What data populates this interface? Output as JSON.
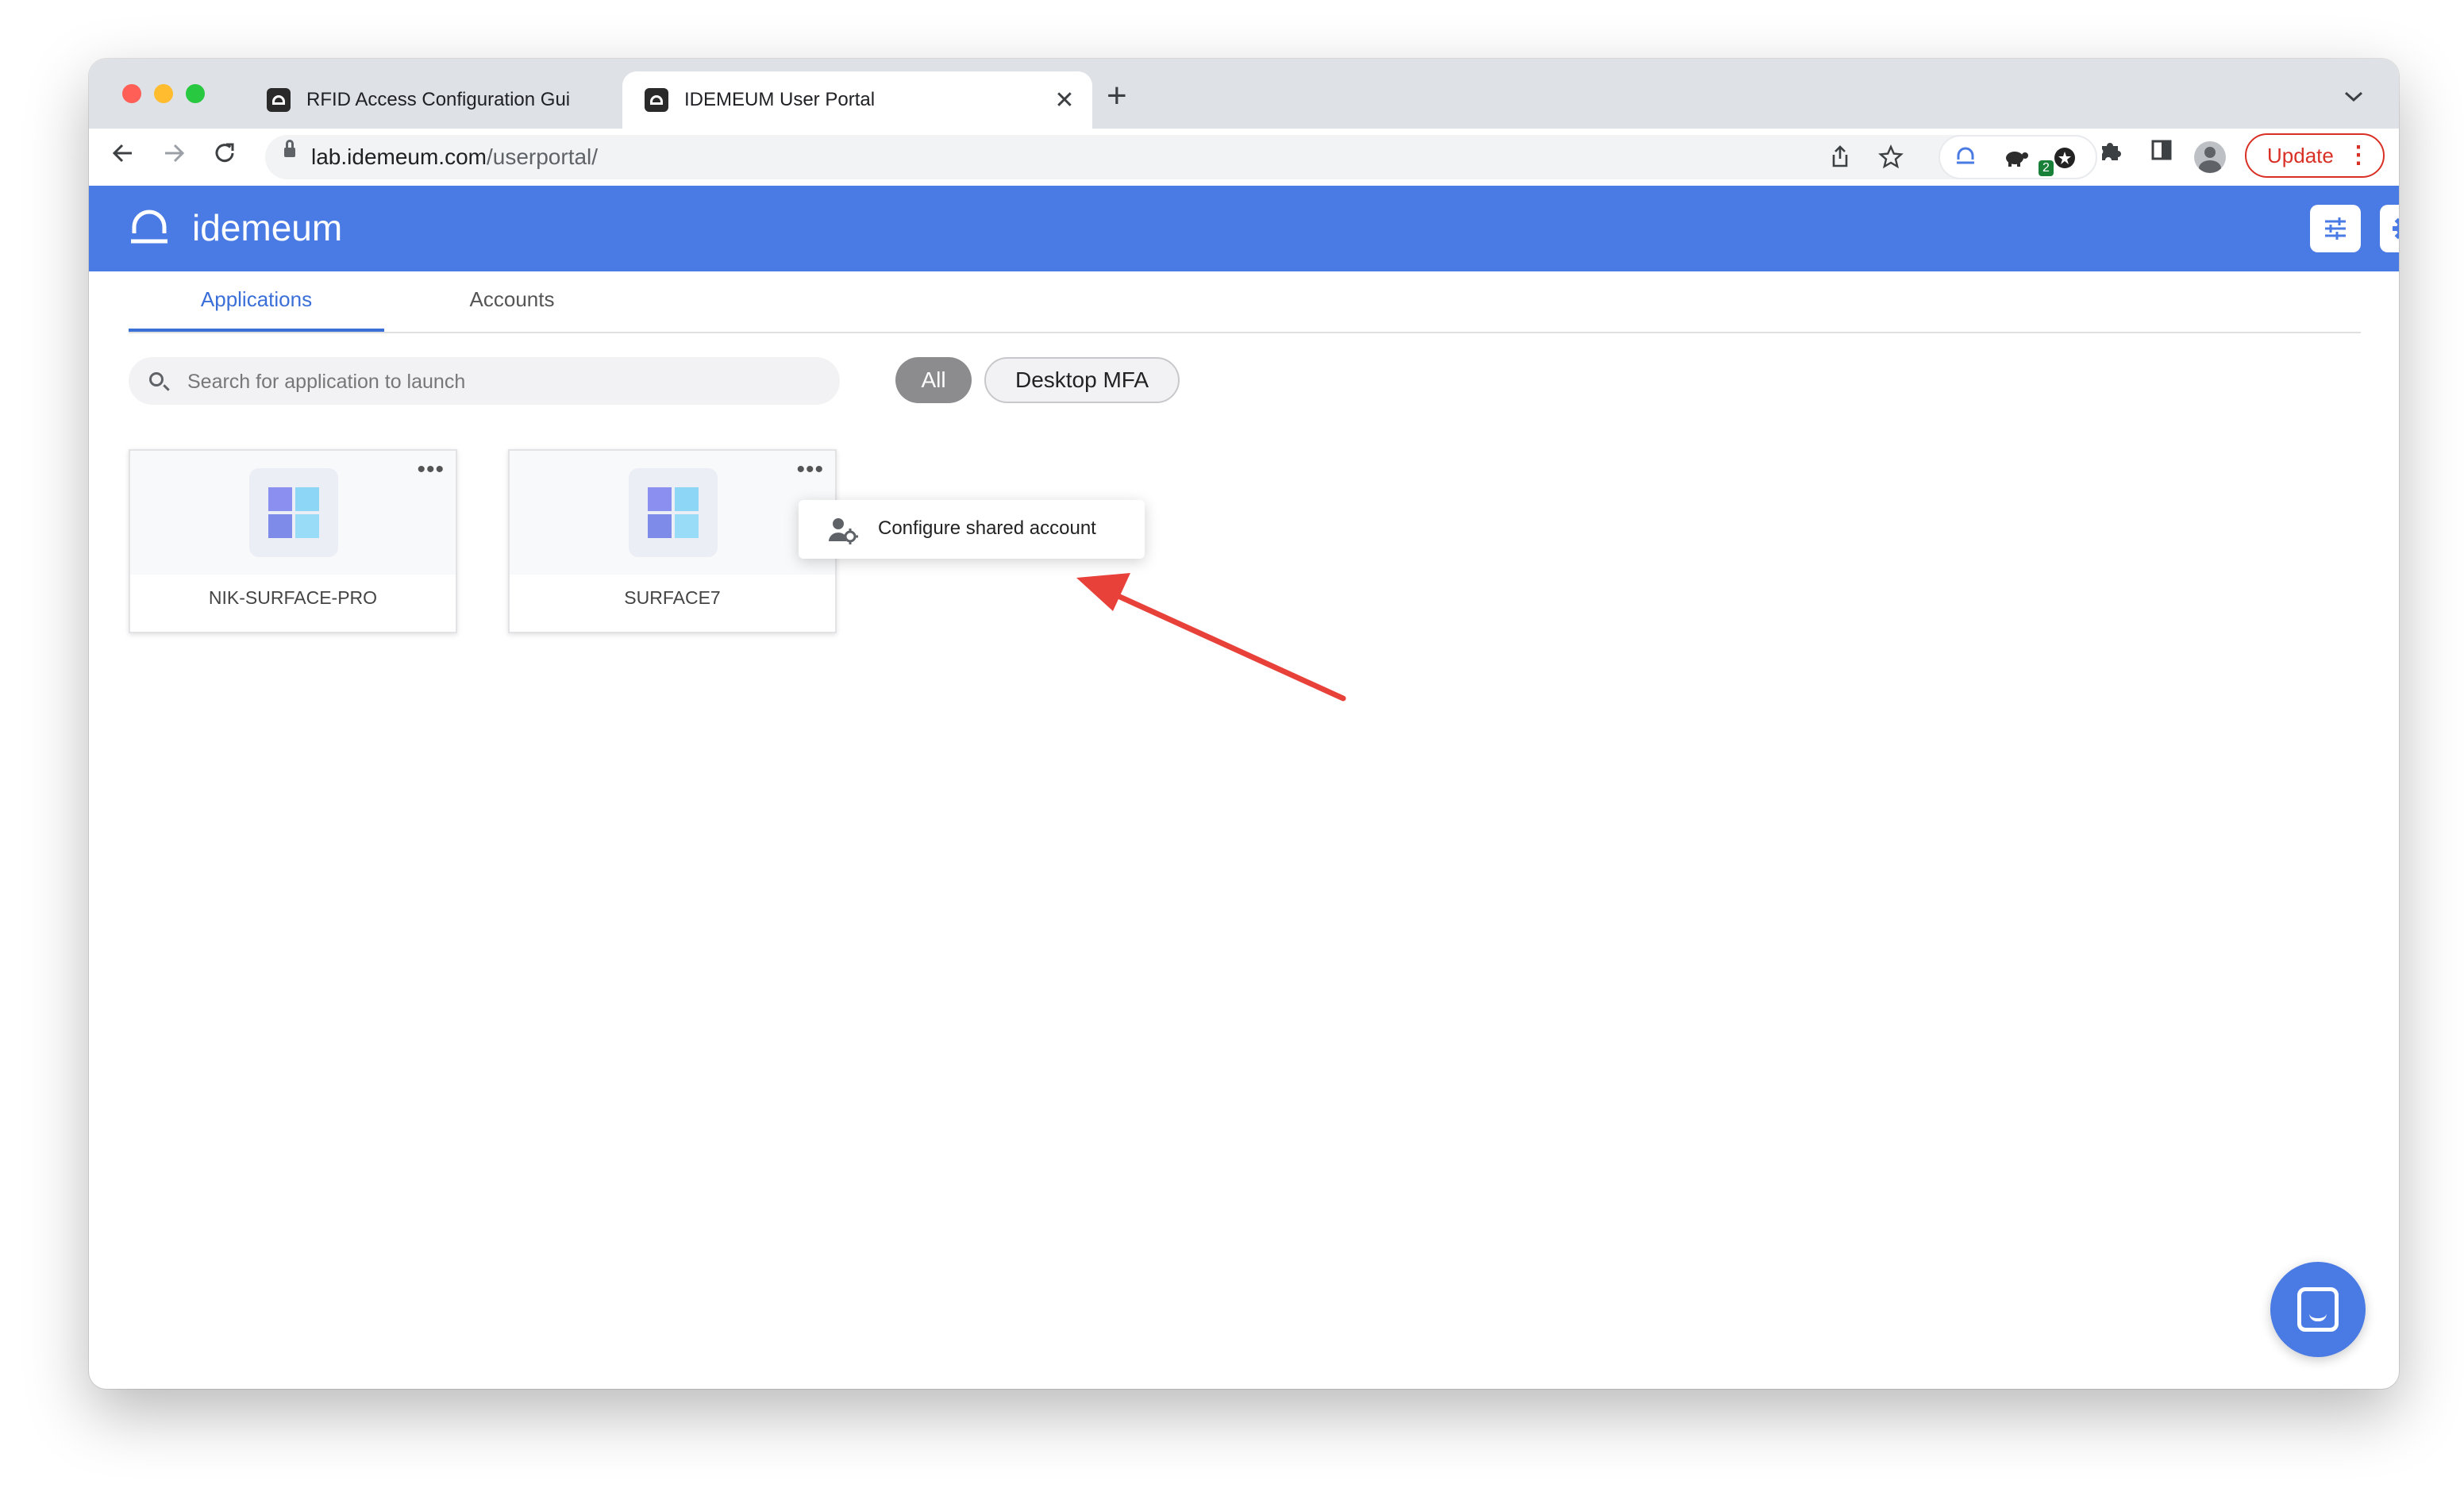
{
  "browser": {
    "tabs": [
      {
        "title": "RFID Access Configuration Gui",
        "active": false
      },
      {
        "title": "IDEMEUM User Portal",
        "active": true
      }
    ],
    "new_tab_symbol": "+",
    "close_symbol": "✕",
    "tab_menu_symbol": "⌄",
    "url_host": "lab.idemeum.com",
    "url_path": "/userportal/",
    "update_label": "Update",
    "extension_badge": "2",
    "icons": [
      "back-icon",
      "forward-icon",
      "reload-icon",
      "lock-icon",
      "share-icon",
      "bookmark-star-icon",
      "idemeum-extension-icon",
      "turtle-extension-icon",
      "badge-extension-icon",
      "puzzle-extensions-icon",
      "side-panel-icon",
      "profile-avatar-icon",
      "more-vert-icon"
    ]
  },
  "app": {
    "brand": "idemeum",
    "brand_color": "#4a7be4",
    "header_icons": [
      "tune-icon",
      "settings-gear-icon"
    ],
    "tabs": [
      {
        "label": "Applications",
        "active": true
      },
      {
        "label": "Accounts",
        "active": false
      }
    ],
    "search": {
      "placeholder": "Search for application to launch",
      "value": ""
    },
    "filters": [
      {
        "label": "All",
        "selected": true
      },
      {
        "label": "Desktop MFA",
        "selected": false
      }
    ],
    "cards": [
      {
        "name": "NIK-SURFACE-PRO",
        "icon": "windows-logo-icon"
      },
      {
        "name": "SURFACE7",
        "icon": "windows-logo-icon"
      }
    ],
    "context_menu": {
      "items": [
        {
          "label": "Configure shared account",
          "icon": "user-gear-icon"
        }
      ]
    },
    "chat_icon": "chat-bubble-icon"
  },
  "annotation": {
    "type": "arrow",
    "color": "#e8413a"
  }
}
